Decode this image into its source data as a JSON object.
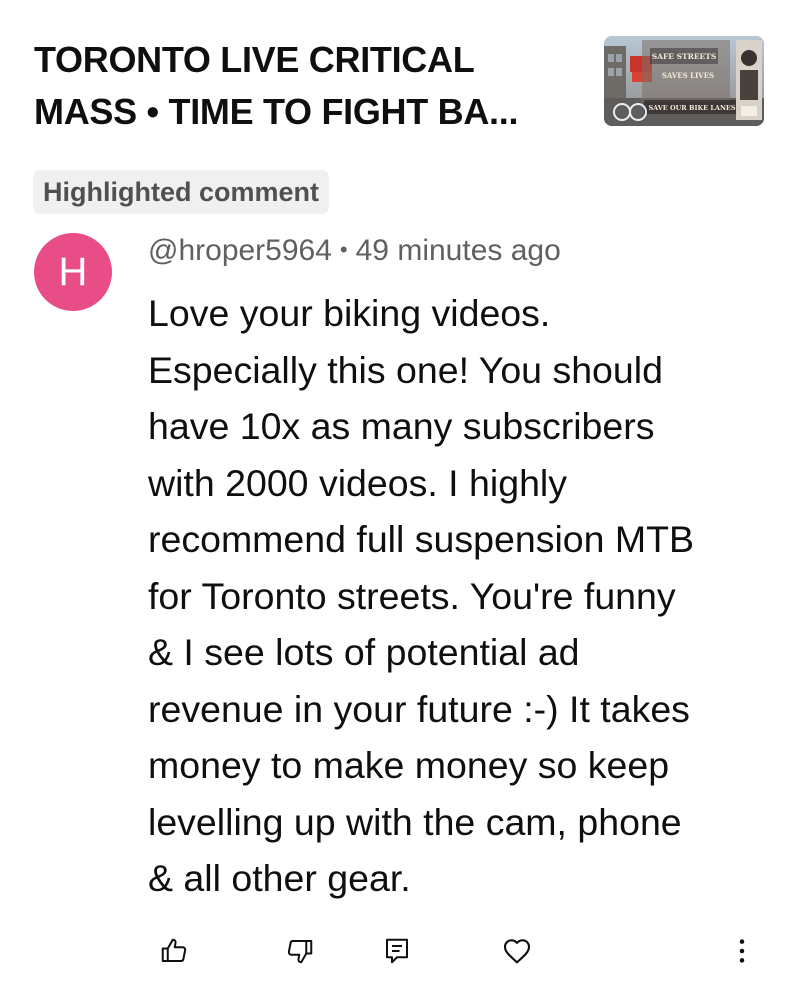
{
  "video": {
    "title": "TORONTO LIVE CRITICAL\nMASS • TIME TO FIGHT BA...",
    "thumbnail_text": {
      "line1": "SAFE STREETS",
      "line2": "SAVES LIVES",
      "line3": "SAVE OUR BIKE LANES"
    }
  },
  "comment": {
    "badge": "Highlighted comment",
    "avatar_letter": "H",
    "avatar_color": "#e84d87",
    "author": "@hroper5964",
    "separator": "•",
    "time": "49 minutes ago",
    "text": "Love your biking videos.\nEspecially this one! You should\nhave 10x as many subscribers\nwith 2000 videos. I highly\nrecommend full suspension MTB\nfor Toronto streets. You're funny\n& I see lots of potential ad\nrevenue in your future :-) It takes\nmoney to make money so keep\nlevelling up with the cam, phone\n& all other gear."
  },
  "actions": {
    "icons": [
      "thumb-up-icon",
      "thumb-down-icon",
      "reply-icon",
      "heart-icon",
      "more-vertical-icon"
    ]
  }
}
